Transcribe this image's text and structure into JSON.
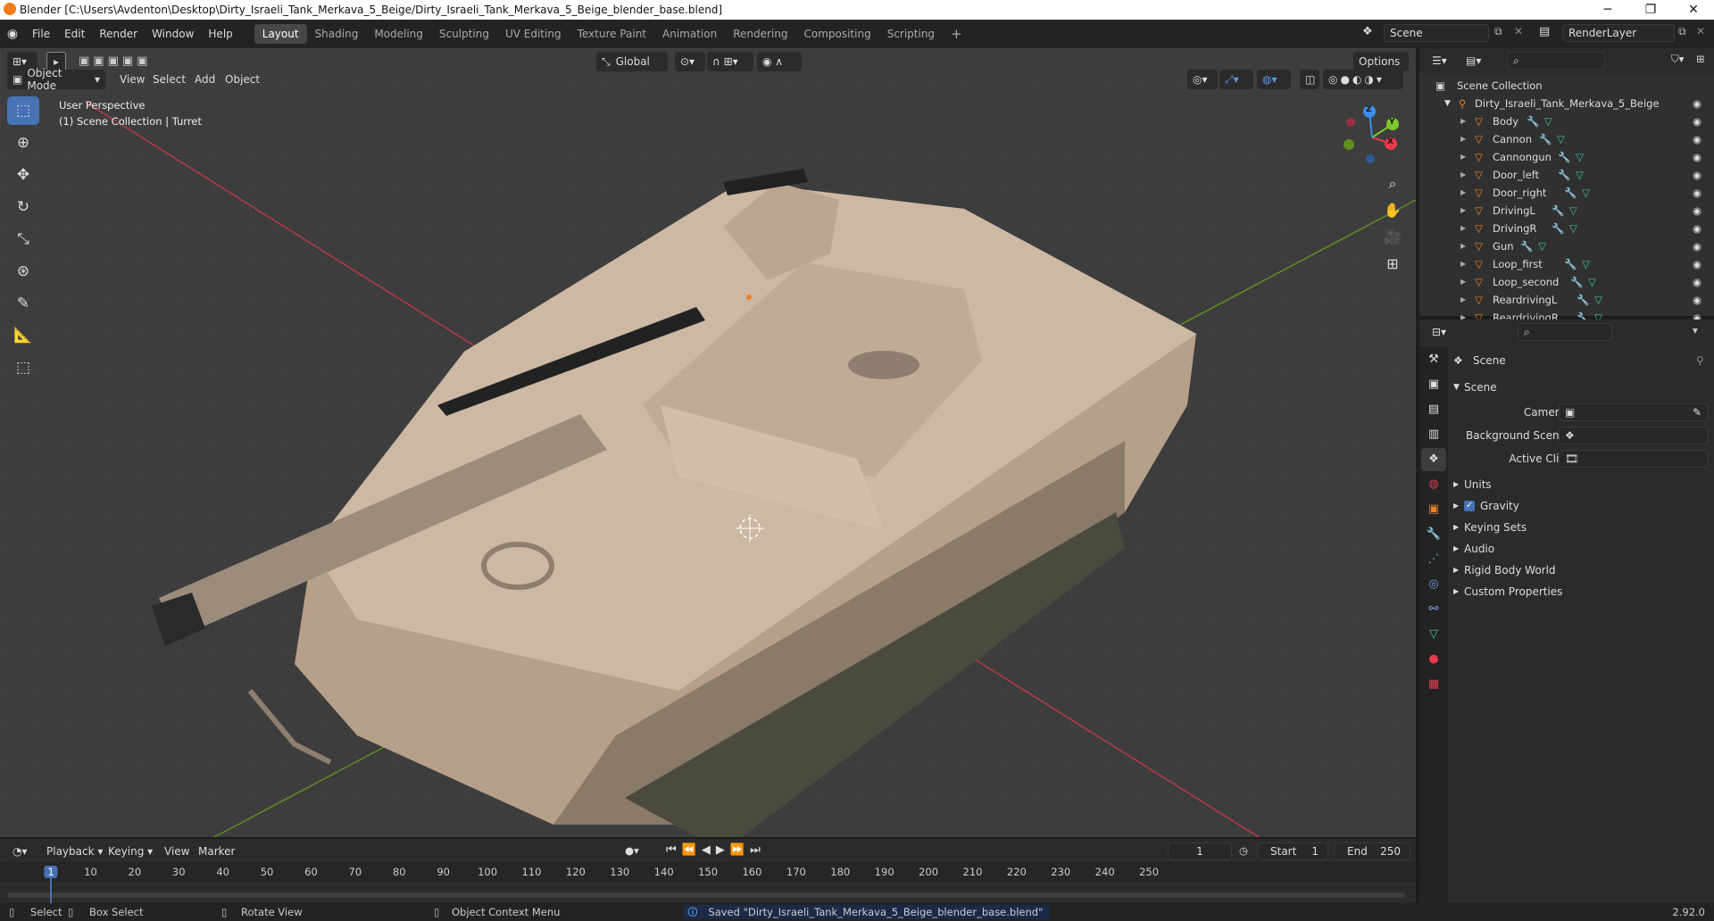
{
  "window": {
    "title": "Blender [C:\\Users\\Avdenton\\Desktop\\Dirty_Israeli_Tank_Merkava_5_Beige/Dirty_Israeli_Tank_Merkava_5_Beige_blender_base.blend]",
    "minimize": "─",
    "maximize": "❐",
    "close": "✕"
  },
  "menus": [
    "File",
    "Edit",
    "Render",
    "Window",
    "Help"
  ],
  "workspaces": [
    {
      "label": "Layout",
      "active": true
    },
    {
      "label": "Shading"
    },
    {
      "label": "Modeling"
    },
    {
      "label": "Sculpting"
    },
    {
      "label": "UV Editing"
    },
    {
      "label": "Texture Paint"
    },
    {
      "label": "Animation"
    },
    {
      "label": "Rendering"
    },
    {
      "label": "Compositing"
    },
    {
      "label": "Scripting"
    }
  ],
  "add_workspace": "+",
  "scene_field": "Scene",
  "renderlayer_field": "RenderLayer",
  "viewport": {
    "mode": "Object Mode",
    "menus": [
      "View",
      "Select",
      "Add",
      "Object"
    ],
    "orientation": "Global",
    "options": "Options",
    "info_line1": "User Perspective",
    "info_line2": "(1) Scene Collection | Turret",
    "gizmo": {
      "x": "X",
      "y": "Y",
      "z": "Z"
    }
  },
  "outliner": {
    "root": "Scene Collection",
    "collection": "Dirty_Israeli_Tank_Merkava_5_Beige",
    "objects": [
      "Body",
      "Cannon",
      "Cannongun",
      "Door_left",
      "Door_right",
      "DrivingL",
      "DrivingR",
      "Gun",
      "Loop_first",
      "Loop_second",
      "ReardrivingL",
      "ReardrivingR"
    ]
  },
  "properties": {
    "header": "Scene",
    "panel": "Scene",
    "camera_label": "Camera",
    "background_scene_label": "Background Scene",
    "active_clip_label": "Active Clip",
    "sections": [
      {
        "label": "Units",
        "checkbox": false
      },
      {
        "label": "Gravity",
        "checkbox": true,
        "checked": true
      },
      {
        "label": "Keying Sets",
        "checkbox": false
      },
      {
        "label": "Audio",
        "checkbox": false
      },
      {
        "label": "Rigid Body World",
        "checkbox": false
      },
      {
        "label": "Custom Properties",
        "checkbox": false
      }
    ]
  },
  "timeline": {
    "menus": [
      "Playback",
      "Keying",
      "View",
      "Marker"
    ],
    "current_frame": "1",
    "start_label": "Start",
    "start": "1",
    "end_label": "End",
    "end": "250",
    "ruler": [
      "1",
      "10",
      "20",
      "30",
      "40",
      "50",
      "60",
      "70",
      "80",
      "90",
      "100",
      "110",
      "120",
      "130",
      "140",
      "150",
      "160",
      "170",
      "180",
      "190",
      "200",
      "210",
      "220",
      "230",
      "240",
      "250"
    ]
  },
  "statusbar": {
    "select": "Select",
    "box_select": "Box Select",
    "rotate_view": "Rotate View",
    "context_menu": "Object Context Menu",
    "message": "Saved \"Dirty_Israeli_Tank_Merkava_5_Beige_blender_base.blend\"",
    "version": "2.92.0"
  },
  "colors": {
    "accent": "#4772b3",
    "object_icon": "#e8832a",
    "mesh_icon": "#3fc4a6",
    "modifier_icon": "#7aa6e8",
    "axis_x": "#e8394d",
    "axis_y": "#7fc72c",
    "axis_z": "#3c8de8",
    "tank": "#c9b49e"
  }
}
